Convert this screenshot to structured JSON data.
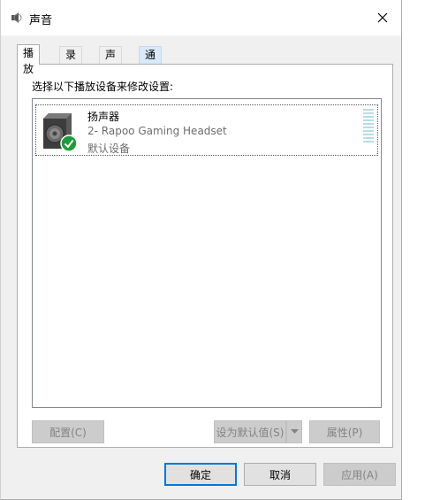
{
  "window": {
    "title": "声音",
    "close_glyph": "✕"
  },
  "tabs": [
    {
      "label": "播放",
      "active": true
    },
    {
      "label": "录制",
      "active": false
    },
    {
      "label": "声音",
      "active": false
    },
    {
      "label": "通信",
      "active": false
    }
  ],
  "panel": {
    "instruction": "选择以下播放设备来修改设置:"
  },
  "devices": [
    {
      "name": "扬声器",
      "description": "2- Rapoo Gaming Headset",
      "status": "默认设备",
      "icon": "speaker-icon",
      "badge": "default-check-icon",
      "level_meter_segments": 10
    }
  ],
  "panel_buttons": {
    "configure": "配置(C)",
    "set_default": "设为默认值(S)",
    "properties": "属性(P)"
  },
  "dialog_buttons": {
    "ok": "确定",
    "cancel": "取消",
    "apply": "应用(A)"
  },
  "colors": {
    "accent": "#0078d7",
    "check_badge": "#1e9b3a",
    "tab_hover": "#d8eaf9",
    "level_meter": "#b7dde6"
  }
}
